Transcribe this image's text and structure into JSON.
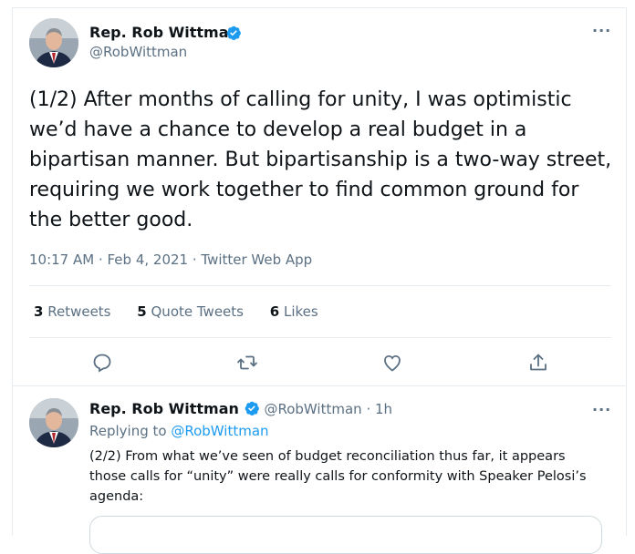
{
  "main_tweet": {
    "author_name": "Rep. Rob Wittman",
    "author_handle": "@RobWittman",
    "text": "(1/2) After months of calling for unity, I was optimistic we’d have a chance to develop a real budget in a bipartisan manner. But bipartisanship is a two-way street, requiring we work together to find common ground for the better good.",
    "meta": "10:17 AM · Feb 4, 2021 · Twitter Web App",
    "stats": {
      "retweets_count": "3",
      "retweets_label": "Retweets",
      "quotes_count": "5",
      "quotes_label": "Quote Tweets",
      "likes_count": "6",
      "likes_label": "Likes"
    },
    "more": "···"
  },
  "reply_tweet": {
    "author_name": "Rep. Rob Wittman",
    "author_handle": "@RobWittman",
    "sep": "·",
    "time": "1h",
    "replying_prefix": "Replying to",
    "replying_handle": "@RobWittman",
    "text": "(2/2) From what we’ve seen of budget reconciliation thus far, it appears those calls for “unity” were really calls for conformity with Speaker Pelosi’s agenda:",
    "more": "···"
  },
  "icons": [
    "reply-icon",
    "retweet-icon",
    "like-icon",
    "share-icon",
    "verified-badge-icon",
    "more-icon"
  ],
  "colors": {
    "accent": "#1d9bf0",
    "secondary_text": "#5b7083",
    "divider": "#e6ecf0"
  }
}
